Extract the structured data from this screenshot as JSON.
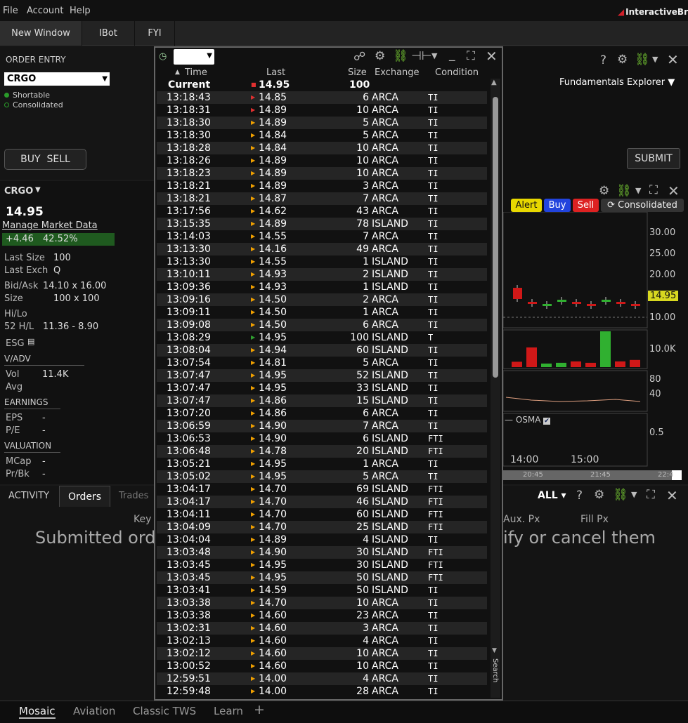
{
  "menu": {
    "file": "File",
    "account": "Account",
    "help": "Help",
    "brand": "InteractiveBr"
  },
  "toptabs": [
    "New Window",
    "IBot",
    "FYI"
  ],
  "order_entry": {
    "title": "ORDER ENTRY",
    "symbol": "CRGO",
    "shortable": "Shortable",
    "consolidated": "Consolidated",
    "buy": "BUY",
    "sell": "SELL",
    "submit": "SUBMIT",
    "fundamentals": "Fundamentals Explorer"
  },
  "quote": {
    "symbol": "CRGO",
    "price": "14.95",
    "manage": "Manage Market Data",
    "change": "+4.46",
    "change_pct": "42.52%",
    "last_size_lbl": "Last Size",
    "last_size": "100",
    "last_exch_lbl": "Last Exch",
    "last_exch": "Q",
    "bidask_lbl": "Bid/Ask",
    "bidask": "14.10 x 16.00",
    "size_lbl": "Size",
    "size": "100 x 100",
    "hilo_lbl": "Hi/Lo",
    "hl52_lbl": "52 H/L",
    "hl52": "11.36 - 8.90",
    "esg": "ESG",
    "vadv": "V/ADV",
    "vol_lbl": "Vol",
    "vol": "11.4K",
    "avg_lbl": "Avg",
    "earnings": "EARNINGS",
    "eps_lbl": "EPS",
    "eps": "-",
    "pe_lbl": "P/E",
    "pe": "-",
    "valuation": "VALUATION",
    "mcap_lbl": "MCap",
    "mcap": "-",
    "prbk_lbl": "Pr/Bk",
    "prbk": "-"
  },
  "chart": {
    "alert": "Alert",
    "buy": "Buy",
    "sell": "Sell",
    "consolidated": "Consolidated",
    "price_ticks": [
      "30.00",
      "25.00",
      "20.00",
      "10.00"
    ],
    "last_price": "14.95",
    "vol_tick": "10.0K",
    "rsi_ticks": [
      "80",
      "40"
    ],
    "osma_label": "OSMA",
    "osma_tick": "0.5",
    "time_ticks": [
      "14:00",
      "15:00"
    ],
    "nav_ticks": [
      "20:45",
      "21:45",
      "22:4"
    ],
    "candles": [
      {
        "up": false,
        "size": "big"
      },
      {
        "up": false
      },
      {
        "up": true
      },
      {
        "up": true
      },
      {
        "up": false
      },
      {
        "up": false
      },
      {
        "up": true
      },
      {
        "up": false
      },
      {
        "up": false
      }
    ],
    "volume_level": [
      0.15,
      0.55,
      0.1,
      0.12,
      0.16,
      0.12,
      1.0,
      0.16,
      0.2
    ]
  },
  "activity": {
    "title": "ACTIVITY",
    "orders": "Orders",
    "trades": "Trades",
    "all": "ALL",
    "col_key": "Key",
    "col_aux": "Aux. Px",
    "col_fill": "Fill Px",
    "msg_left": "Submitted orde",
    "msg_right": "ify or cancel them"
  },
  "bottomtabs": [
    "Mosaic",
    "Aviation",
    "Classic TWS",
    "Learn"
  ],
  "ts": {
    "cols": {
      "time": "Time",
      "last": "Last",
      "size": "Size",
      "exchange": "Exchange",
      "condition": "Condition"
    },
    "search": "Search",
    "current": {
      "time": "Current",
      "last": "14.95",
      "size": "100"
    },
    "rows": [
      [
        "13:18:43",
        "14.85",
        "6",
        "ARCA",
        "TI",
        "red"
      ],
      [
        "13:18:31",
        "14.89",
        "10",
        "ARCA",
        "TI",
        "red"
      ],
      [
        "13:18:30",
        "14.89",
        "5",
        "ARCA",
        "TI",
        "orange"
      ],
      [
        "13:18:30",
        "14.84",
        "5",
        "ARCA",
        "TI",
        "orange"
      ],
      [
        "13:18:28",
        "14.84",
        "10",
        "ARCA",
        "TI",
        "orange"
      ],
      [
        "13:18:26",
        "14.89",
        "10",
        "ARCA",
        "TI",
        "orange"
      ],
      [
        "13:18:23",
        "14.89",
        "10",
        "ARCA",
        "TI",
        "orange"
      ],
      [
        "13:18:21",
        "14.89",
        "3",
        "ARCA",
        "TI",
        "orange"
      ],
      [
        "13:18:21",
        "14.87",
        "7",
        "ARCA",
        "TI",
        "orange"
      ],
      [
        "13:17:56",
        "14.62",
        "43",
        "ARCA",
        "TI",
        "orange"
      ],
      [
        "13:15:35",
        "14.89",
        "78",
        "ISLAND",
        "TI",
        "orange"
      ],
      [
        "13:14:03",
        "14.55",
        "7",
        "ARCA",
        "TI",
        "orange"
      ],
      [
        "13:13:30",
        "14.16",
        "49",
        "ARCA",
        "TI",
        "orange"
      ],
      [
        "13:13:30",
        "14.55",
        "1",
        "ISLAND",
        "TI",
        "orange"
      ],
      [
        "13:10:11",
        "14.93",
        "2",
        "ISLAND",
        "TI",
        "orange"
      ],
      [
        "13:09:36",
        "14.93",
        "1",
        "ISLAND",
        "TI",
        "orange"
      ],
      [
        "13:09:16",
        "14.50",
        "2",
        "ARCA",
        "TI",
        "orange"
      ],
      [
        "13:09:11",
        "14.50",
        "1",
        "ARCA",
        "TI",
        "orange"
      ],
      [
        "13:09:08",
        "14.50",
        "6",
        "ARCA",
        "TI",
        "orange"
      ],
      [
        "13:08:29",
        "14.95",
        "100",
        "ISLAND",
        "T",
        "green"
      ],
      [
        "13:08:04",
        "14.94",
        "60",
        "ISLAND",
        "TI",
        "orange"
      ],
      [
        "13:07:54",
        "14.81",
        "5",
        "ARCA",
        "TI",
        "orange"
      ],
      [
        "13:07:47",
        "14.95",
        "52",
        "ISLAND",
        "TI",
        "orange"
      ],
      [
        "13:07:47",
        "14.95",
        "33",
        "ISLAND",
        "TI",
        "orange"
      ],
      [
        "13:07:47",
        "14.86",
        "15",
        "ISLAND",
        "TI",
        "orange"
      ],
      [
        "13:07:20",
        "14.86",
        "6",
        "ARCA",
        "TI",
        "orange"
      ],
      [
        "13:06:59",
        "14.90",
        "7",
        "ARCA",
        "TI",
        "orange"
      ],
      [
        "13:06:53",
        "14.90",
        "6",
        "ISLAND",
        "FTI",
        "orange"
      ],
      [
        "13:06:48",
        "14.78",
        "20",
        "ISLAND",
        "FTI",
        "orange"
      ],
      [
        "13:05:21",
        "14.95",
        "1",
        "ARCA",
        "TI",
        "orange"
      ],
      [
        "13:05:02",
        "14.95",
        "5",
        "ARCA",
        "TI",
        "orange"
      ],
      [
        "13:04:17",
        "14.70",
        "69",
        "ISLAND",
        "FTI",
        "orange"
      ],
      [
        "13:04:17",
        "14.70",
        "46",
        "ISLAND",
        "FTI",
        "orange"
      ],
      [
        "13:04:11",
        "14.70",
        "60",
        "ISLAND",
        "FTI",
        "orange"
      ],
      [
        "13:04:09",
        "14.70",
        "25",
        "ISLAND",
        "FTI",
        "orange"
      ],
      [
        "13:04:04",
        "14.89",
        "4",
        "ISLAND",
        "TI",
        "orange"
      ],
      [
        "13:03:48",
        "14.90",
        "30",
        "ISLAND",
        "FTI",
        "orange"
      ],
      [
        "13:03:45",
        "14.95",
        "30",
        "ISLAND",
        "FTI",
        "orange"
      ],
      [
        "13:03:45",
        "14.95",
        "50",
        "ISLAND",
        "FTI",
        "orange"
      ],
      [
        "13:03:41",
        "14.59",
        "50",
        "ISLAND",
        "TI",
        "orange"
      ],
      [
        "13:03:38",
        "14.70",
        "10",
        "ARCA",
        "TI",
        "orange"
      ],
      [
        "13:03:38",
        "14.60",
        "23",
        "ARCA",
        "TI",
        "orange"
      ],
      [
        "13:02:31",
        "14.60",
        "3",
        "ARCA",
        "TI",
        "orange"
      ],
      [
        "13:02:13",
        "14.60",
        "4",
        "ARCA",
        "TI",
        "orange"
      ],
      [
        "13:02:12",
        "14.60",
        "10",
        "ARCA",
        "TI",
        "orange"
      ],
      [
        "13:00:52",
        "14.60",
        "10",
        "ARCA",
        "TI",
        "orange"
      ],
      [
        "12:59:51",
        "14.00",
        "4",
        "ARCA",
        "TI",
        "orange"
      ],
      [
        "12:59:48",
        "14.00",
        "28",
        "ARCA",
        "TI",
        "orange"
      ]
    ]
  },
  "colors": {
    "red": "#e03030",
    "orange": "#f0a000",
    "green": "#30a030",
    "pos_bg": "#1f5a1f"
  }
}
